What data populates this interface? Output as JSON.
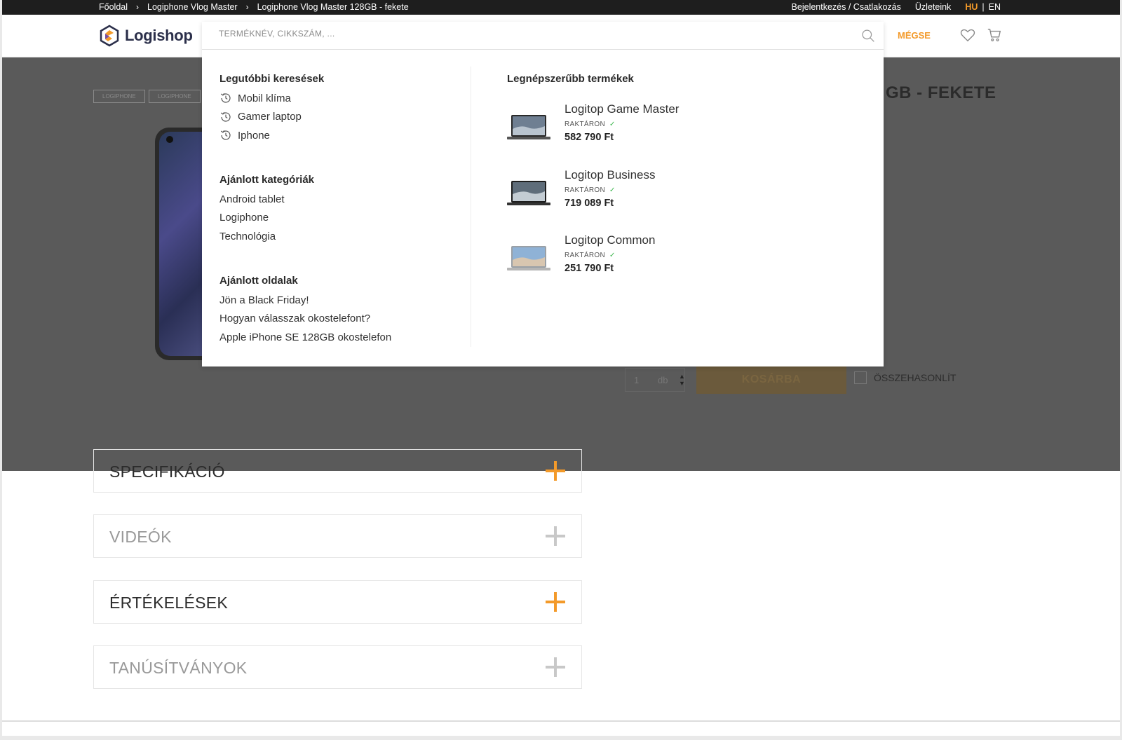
{
  "topbar": {
    "breadcrumbs": [
      "Főoldal",
      "Logiphone Vlog Master",
      "Logiphone Vlog Master 128GB - fekete"
    ],
    "login": "Bejelentkezés / Csatlakozás",
    "stores": "Üzleteink",
    "lang_hu": "HU",
    "lang_sep": "|",
    "lang_en": "EN"
  },
  "header": {
    "logo": "Logishop",
    "cancel": "MÉGSE"
  },
  "search": {
    "placeholder": "TERMÉKNÉV, CIKKSZÁM, ...",
    "recent_title": "Legutóbbi keresések",
    "recent": [
      "Mobil klíma",
      "Gamer laptop",
      "Iphone"
    ],
    "categories_title": "Ajánlott kategóriák",
    "categories": [
      "Android tablet",
      "Logiphone",
      "Technológia"
    ],
    "pages_title": "Ajánlott oldalak",
    "pages": [
      "Jön a Black Friday!",
      "Hogyan válasszak okostelefont?",
      "Apple iPhone SE 128GB okostelefon"
    ],
    "popular_title": "Legnépszerűbb termékek",
    "products": [
      {
        "name": "Logitop Game Master",
        "stock": "RAKTÁRON",
        "price": "582 790 Ft"
      },
      {
        "name": "Logitop Business",
        "stock": "RAKTÁRON",
        "price": "719 089 Ft"
      },
      {
        "name": "Logitop Common",
        "stock": "RAKTÁRON",
        "price": "251 790 Ft"
      }
    ]
  },
  "product": {
    "tags": [
      "LOGIPHONE",
      "LOGIPHONE"
    ],
    "title_fragment": "GB - FEKETE",
    "qty": "1",
    "unit": "db",
    "cart_button": "KOSÁRBA",
    "compare": "ÖSSZEHASONLÍT"
  },
  "accordions": [
    {
      "label": "SPECIFIKÁCIÓ"
    },
    {
      "label": "VIDEÓK"
    },
    {
      "label": "ÉRTÉKELÉSEK"
    },
    {
      "label": "TANÚSÍTVÁNYOK"
    }
  ],
  "colors": {
    "accent": "#f39a2a",
    "overlay": "#5a5a5a",
    "stock_check": "#39b54a"
  }
}
